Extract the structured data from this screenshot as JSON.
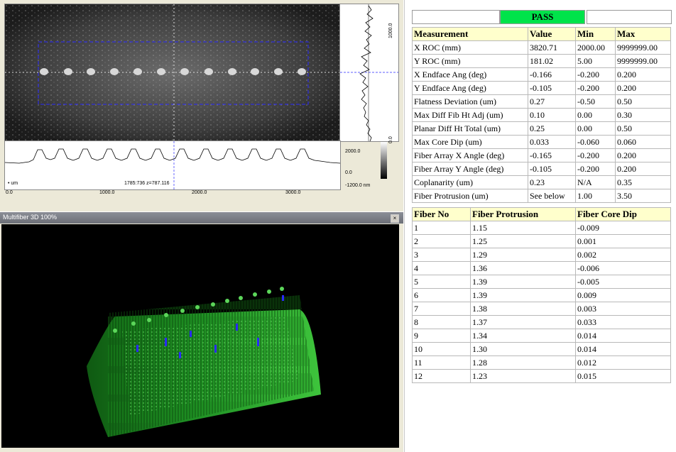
{
  "top_view": {
    "hprofile": {
      "unit_label": "um",
      "cursor_readout": "1785:736 z=787.116",
      "y_ticks": [
        "2000.0",
        "0.0",
        "-1200.0 nm"
      ],
      "x_ticks": [
        "0.0",
        "1000.0",
        "2000.0",
        "3000.0"
      ]
    },
    "vprofile": {
      "ticks": [
        "1000.0",
        "0.0"
      ]
    }
  },
  "window_3d": {
    "title": "Multifiber 3D 100%",
    "close_glyph": "×"
  },
  "status": {
    "result": "PASS",
    "color": "#00e34a"
  },
  "measurements": {
    "headers": [
      "Measurement",
      "Value",
      "Min",
      "Max"
    ],
    "rows": [
      [
        "X ROC (mm)",
        "3820.71",
        "2000.00",
        "9999999.00"
      ],
      [
        "Y ROC (mm)",
        "181.02",
        "5.00",
        "9999999.00"
      ],
      [
        "X Endface Ang (deg)",
        "-0.166",
        "-0.200",
        "0.200"
      ],
      [
        "Y Endface Ang (deg)",
        "-0.105",
        "-0.200",
        "0.200"
      ],
      [
        "Flatness Deviation (um)",
        "0.27",
        "-0.50",
        "0.50"
      ],
      [
        "Max Diff Fib Ht Adj (um)",
        "0.10",
        "0.00",
        "0.30"
      ],
      [
        "Planar Diff Ht Total (um)",
        "0.25",
        "0.00",
        "0.50"
      ],
      [
        "Max Core Dip (um)",
        "0.033",
        "-0.060",
        "0.060"
      ],
      [
        "Fiber Array X Angle (deg)",
        "-0.165",
        "-0.200",
        "0.200"
      ],
      [
        "Fiber Array Y Angle (deg)",
        "-0.105",
        "-0.200",
        "0.200"
      ],
      [
        "Coplanarity (um)",
        "0.23",
        "N/A",
        "0.35"
      ],
      [
        "Fiber Protrusion (um)",
        "See below",
        "1.00",
        "3.50"
      ]
    ]
  },
  "fibers": {
    "headers": [
      "Fiber No",
      "Fiber Protrusion",
      "Fiber Core Dip"
    ],
    "rows": [
      [
        "1",
        "1.15",
        "-0.009"
      ],
      [
        "2",
        "1.25",
        "0.001"
      ],
      [
        "3",
        "1.29",
        "0.002"
      ],
      [
        "4",
        "1.36",
        "-0.006"
      ],
      [
        "5",
        "1.39",
        "-0.005"
      ],
      [
        "6",
        "1.39",
        "0.009"
      ],
      [
        "7",
        "1.38",
        "0.003"
      ],
      [
        "8",
        "1.37",
        "0.033"
      ],
      [
        "9",
        "1.34",
        "0.014"
      ],
      [
        "10",
        "1.30",
        "0.014"
      ],
      [
        "11",
        "1.28",
        "0.012"
      ],
      [
        "12",
        "1.23",
        "0.015"
      ]
    ]
  }
}
